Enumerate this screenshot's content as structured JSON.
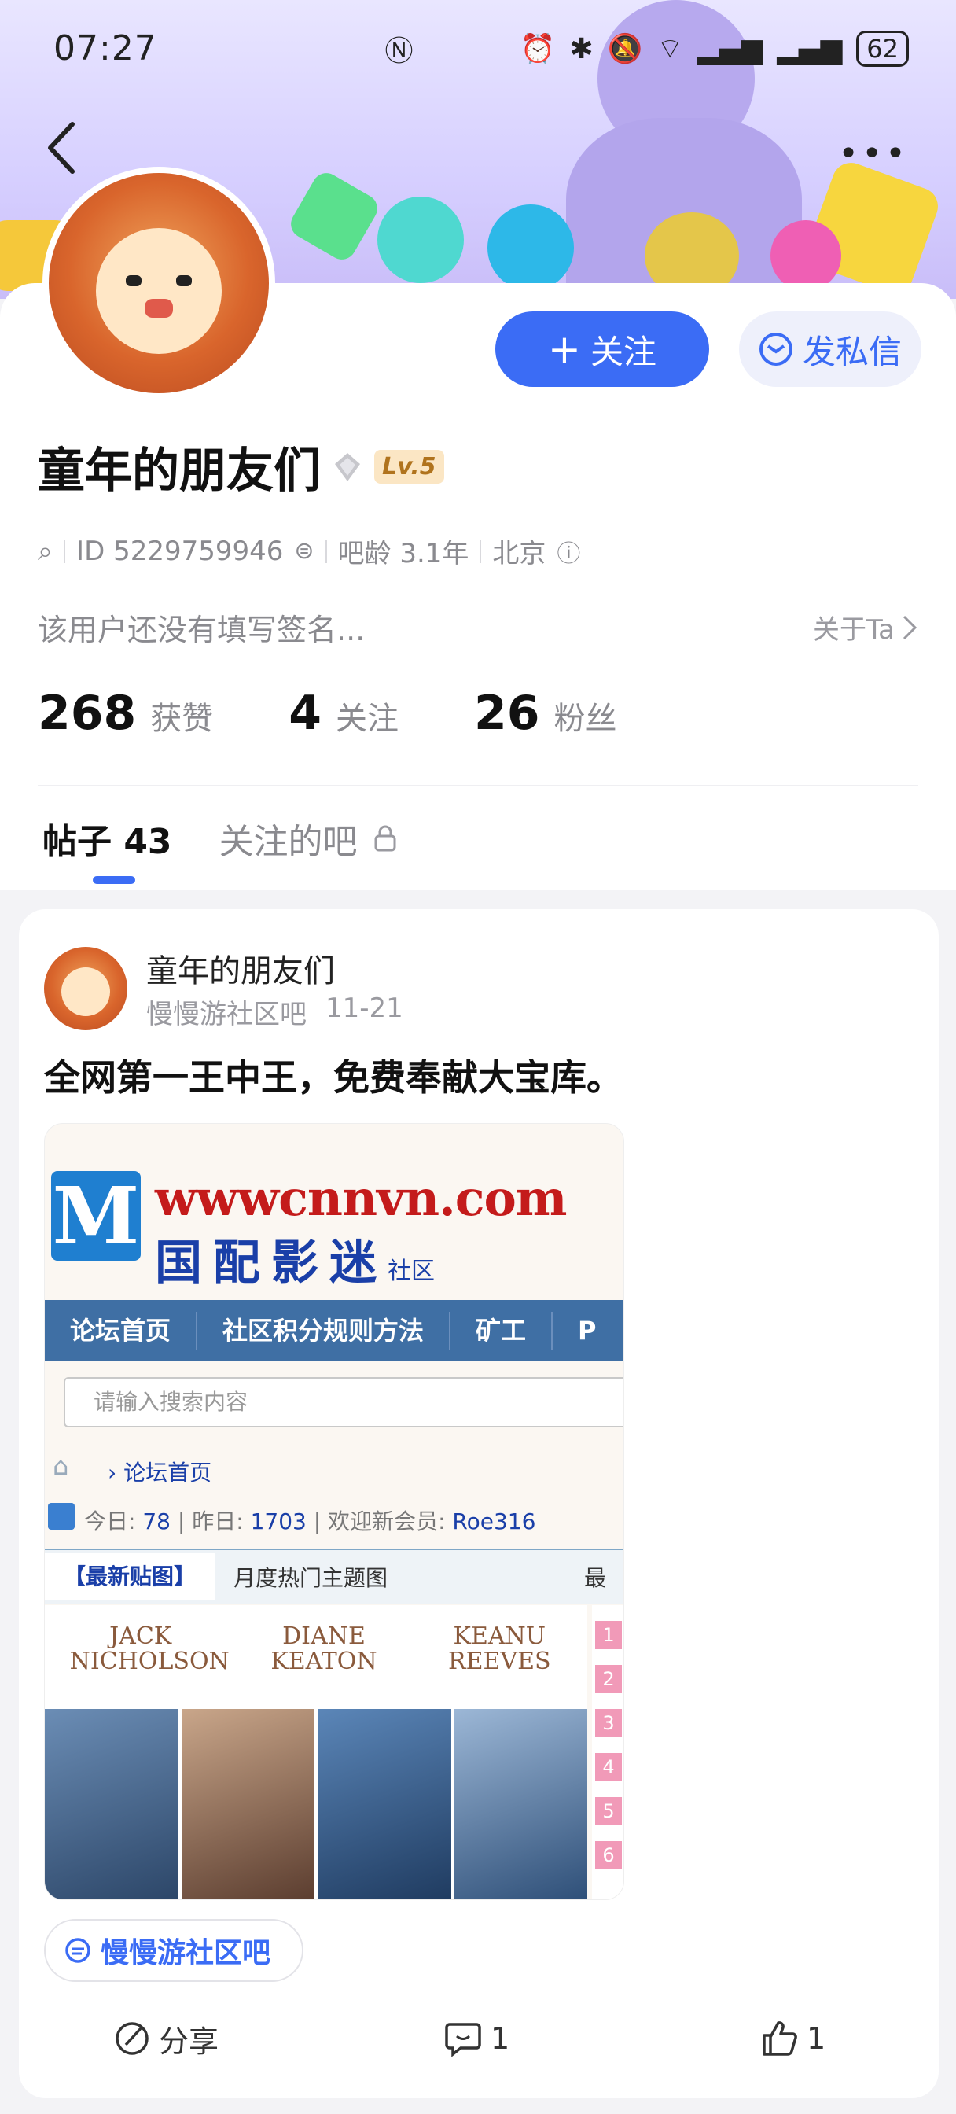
{
  "status_bar": {
    "time": "07:27",
    "battery": "62"
  },
  "profile": {
    "follow_label": "关注",
    "message_label": "发私信",
    "username": "童年的朋友们",
    "level": "Lv.5",
    "id_text": "ID 5229759946",
    "age_text": "吧龄 3.1年",
    "location": "北京",
    "signature": "该用户还没有填写签名...",
    "about_label": "关于Ta",
    "stats": [
      {
        "num": "268",
        "label": "获赞"
      },
      {
        "num": "4",
        "label": "关注"
      },
      {
        "num": "26",
        "label": "粉丝"
      }
    ]
  },
  "tabs": {
    "posts": "帖子 43",
    "followed_bars": "关注的吧"
  },
  "post": {
    "author": "童年的朋友们",
    "forum": "慢慢游社区吧",
    "date": "11-21",
    "title": "全网第一王中王，免费奉献大宝库。",
    "image": {
      "url_text": "wwwcnnvn.com",
      "site_name": "国配影迷",
      "site_name_sub": "社区",
      "nav": [
        "论坛首页",
        "社区积分规则方法",
        "矿工",
        "P"
      ],
      "search_placeholder": "请输入搜索内容",
      "crumb": "论坛首页",
      "stats_today_label": "今日:",
      "stats_today": "78",
      "stats_yesterday_label": "昨日:",
      "stats_yesterday": "1703",
      "stats_welcome_label": "欢迎新会员:",
      "stats_member": "Roe316",
      "tab_active": "【最新贴图】",
      "tab_other": "月度热门主题图",
      "tab_cut": "最",
      "movie_names": [
        "JACK NICHOLSON",
        "DIANE KEATON",
        "KEANU REEVES"
      ],
      "ranks": [
        "1",
        "2",
        "3",
        "4",
        "5",
        "6"
      ]
    },
    "forum_chip": "慢慢游社区吧",
    "share_label": "分享",
    "comment_count": "1",
    "like_count": "1"
  },
  "colors": {
    "accent": "#3b6cf5",
    "banner": "#d6cfff"
  }
}
